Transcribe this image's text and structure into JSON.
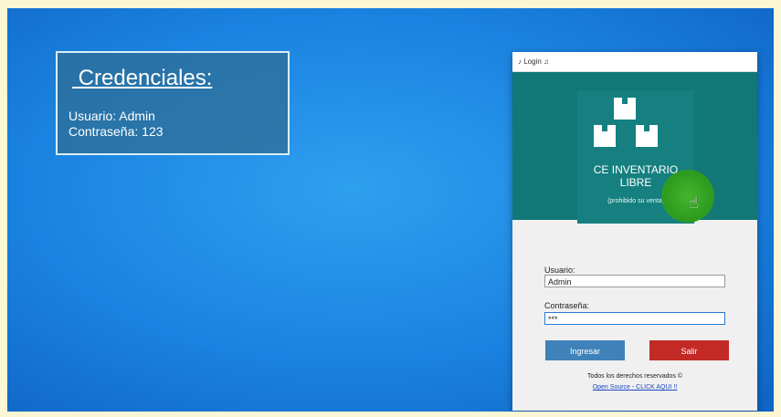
{
  "credentials": {
    "title": " Credenciales:",
    "user_line": "Usuario: Admin",
    "password_line": "Contraseña: 123"
  },
  "window": {
    "title": "♪ Login ♫"
  },
  "banner": {
    "app_name": "CE INVENTARIO LIBRE",
    "subtitle": "(prohibido su venta)",
    "cursor_icon": "hand-pointer-icon"
  },
  "form": {
    "user_label": "Usuario:",
    "user_value": "Admin",
    "password_label": "Contraseña:",
    "password_value": "***"
  },
  "buttons": {
    "login": "Ingresar",
    "exit": "Salir"
  },
  "footer": {
    "rights": "Todos los derechos reservados ©",
    "link": "Open Source - CLICK AQUI !!"
  },
  "colors": {
    "banner": "#127777",
    "login_button": "#3e82b9",
    "exit_button": "#c32a25",
    "desktop": "#1a82e0"
  }
}
